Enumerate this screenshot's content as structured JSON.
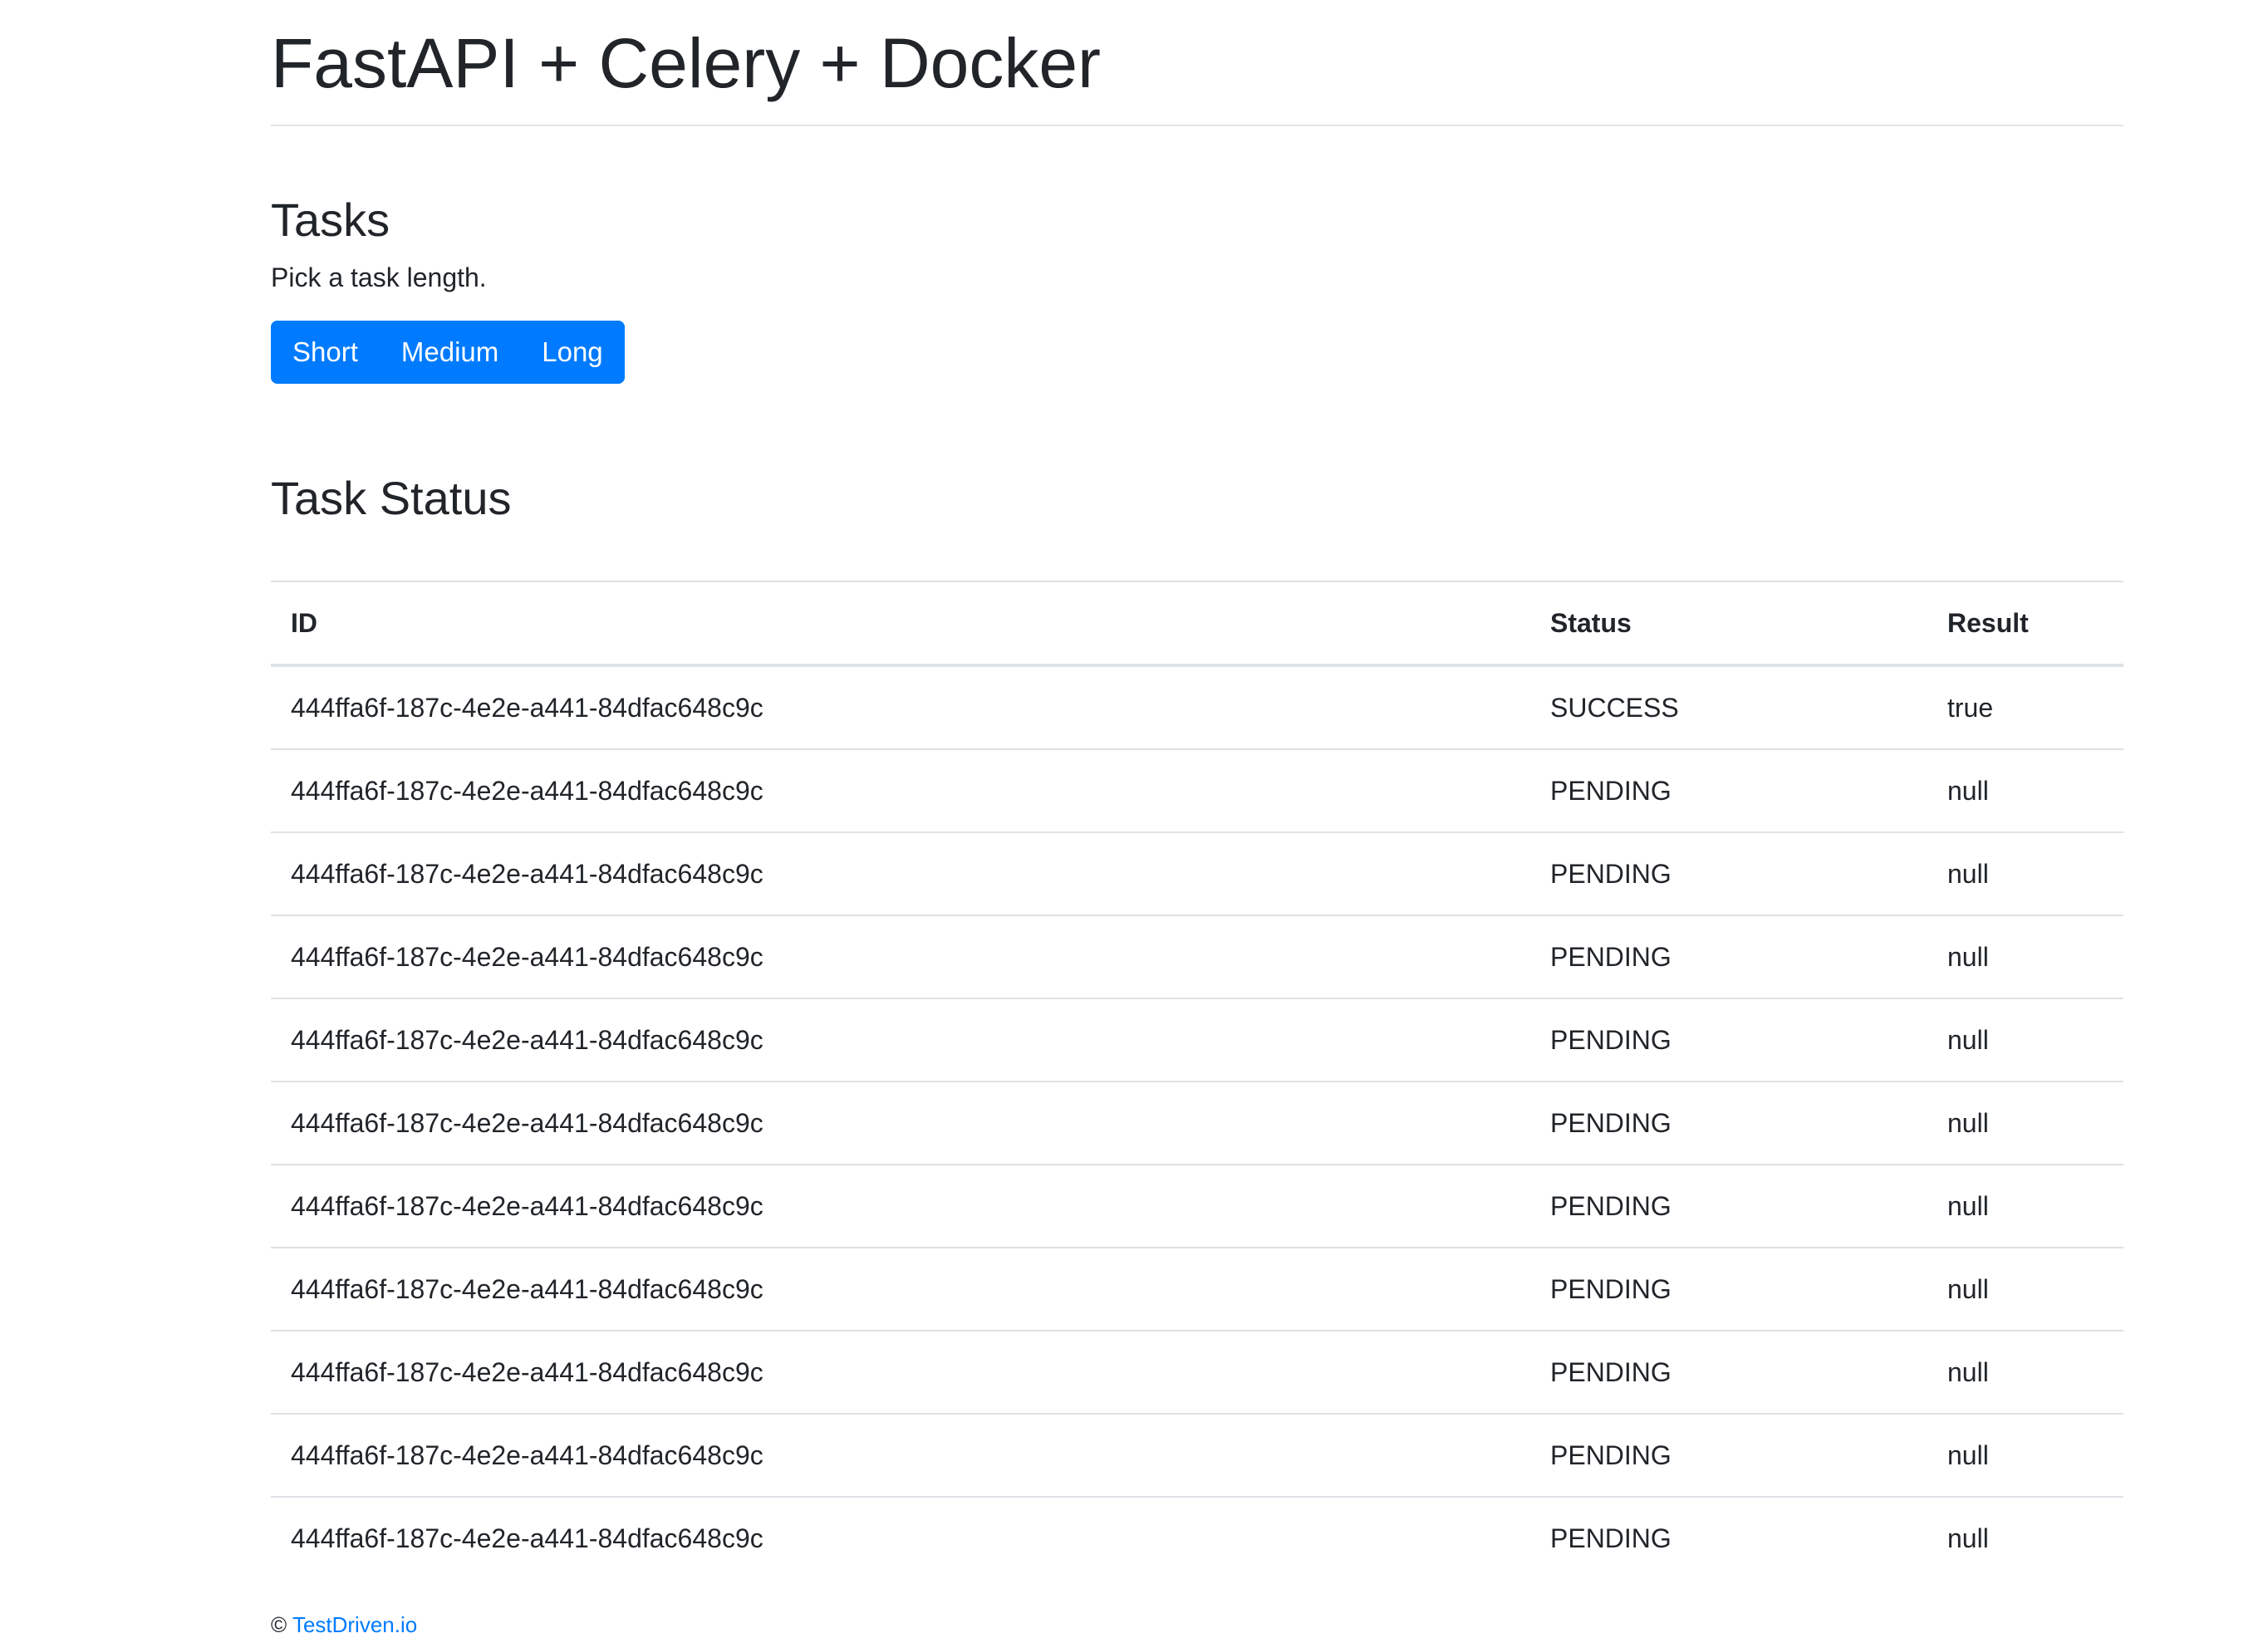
{
  "header": {
    "title": "FastAPI + Celery + Docker"
  },
  "tasks": {
    "heading": "Tasks",
    "instructions": "Pick a task length.",
    "buttons": [
      "Short",
      "Medium",
      "Long"
    ],
    "button_color": "#007bff"
  },
  "status": {
    "heading": "Task Status",
    "columns": [
      "ID",
      "Status",
      "Result"
    ],
    "rows": [
      {
        "id": "444ffa6f-187c-4e2e-a441-84dfac648c9c",
        "status": "SUCCESS",
        "result": "true"
      },
      {
        "id": "444ffa6f-187c-4e2e-a441-84dfac648c9c",
        "status": "PENDING",
        "result": "null"
      },
      {
        "id": "444ffa6f-187c-4e2e-a441-84dfac648c9c",
        "status": "PENDING",
        "result": "null"
      },
      {
        "id": "444ffa6f-187c-4e2e-a441-84dfac648c9c",
        "status": "PENDING",
        "result": "null"
      },
      {
        "id": "444ffa6f-187c-4e2e-a441-84dfac648c9c",
        "status": "PENDING",
        "result": "null"
      },
      {
        "id": "444ffa6f-187c-4e2e-a441-84dfac648c9c",
        "status": "PENDING",
        "result": "null"
      },
      {
        "id": "444ffa6f-187c-4e2e-a441-84dfac648c9c",
        "status": "PENDING",
        "result": "null"
      },
      {
        "id": "444ffa6f-187c-4e2e-a441-84dfac648c9c",
        "status": "PENDING",
        "result": "null"
      },
      {
        "id": "444ffa6f-187c-4e2e-a441-84dfac648c9c",
        "status": "PENDING",
        "result": "null"
      },
      {
        "id": "444ffa6f-187c-4e2e-a441-84dfac648c9c",
        "status": "PENDING",
        "result": "null"
      },
      {
        "id": "444ffa6f-187c-4e2e-a441-84dfac648c9c",
        "status": "PENDING",
        "result": "null"
      }
    ]
  },
  "footer": {
    "copyright": "©",
    "link_text": "TestDriven.io",
    "link_color": "#007bff"
  }
}
